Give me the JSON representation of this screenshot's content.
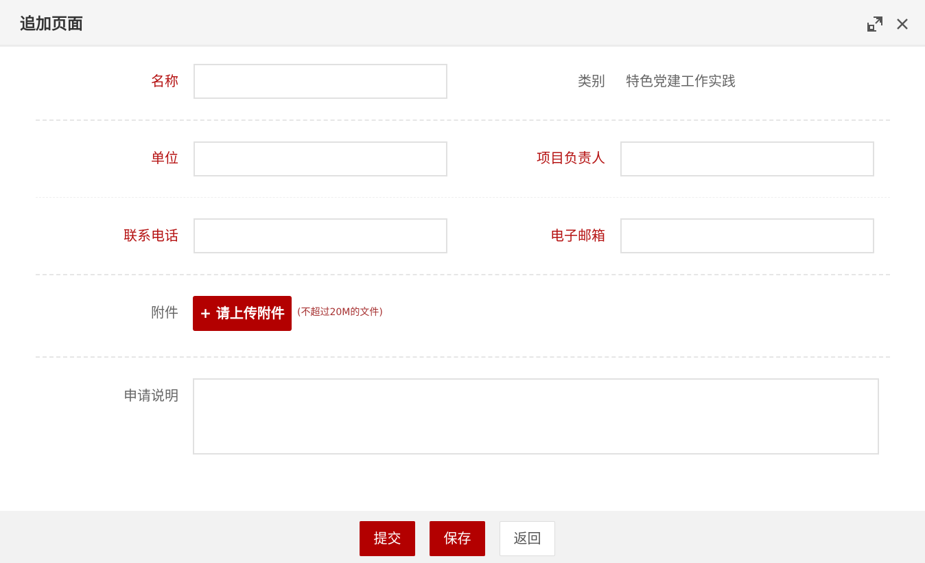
{
  "dialog": {
    "title": "追加页面",
    "maximize_icon": "maximize-icon",
    "close_icon": "close-icon"
  },
  "form": {
    "name": {
      "label": "名称",
      "value": "",
      "required": true
    },
    "category": {
      "label": "类别",
      "value": "特色党建工作实践",
      "required": false
    },
    "unit": {
      "label": "单位",
      "value": "",
      "required": true
    },
    "project_lead": {
      "label": "项目负责人",
      "value": "",
      "required": true
    },
    "phone": {
      "label": "联系电话",
      "value": "",
      "required": true
    },
    "email": {
      "label": "电子邮箱",
      "value": "",
      "required": true
    },
    "attachment": {
      "label": "附件",
      "upload_label": "+ 请上传附件",
      "hint": "(不超过20M的文件)"
    },
    "description": {
      "label": "申请说明",
      "value": ""
    }
  },
  "footer": {
    "submit_label": "提交",
    "save_label": "保存",
    "back_label": "返回"
  },
  "colors": {
    "accent": "#b30000",
    "required_label": "#b51212",
    "optional_label": "#666666"
  }
}
